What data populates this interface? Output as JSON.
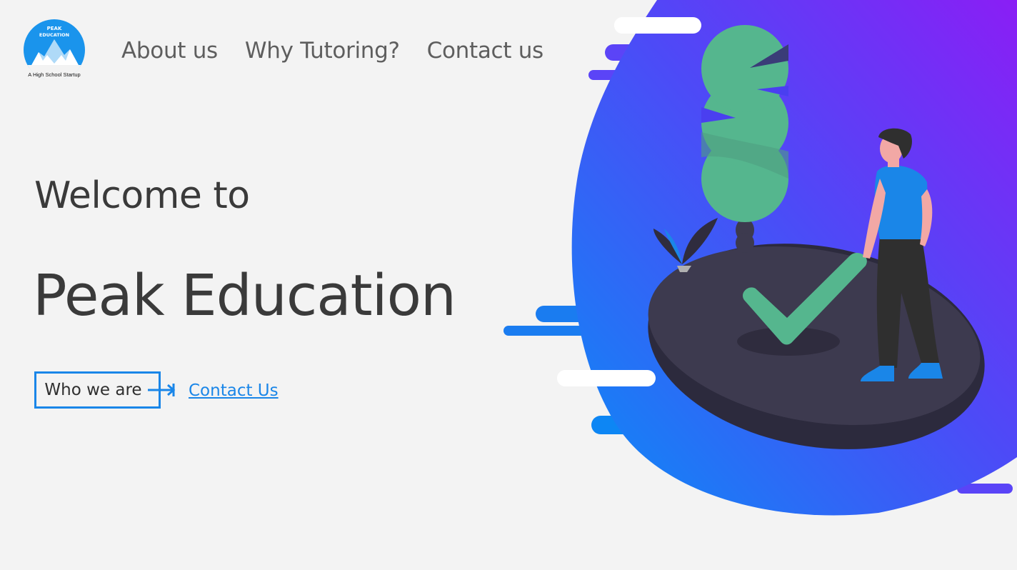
{
  "brand": {
    "logo_line1": "PEAK",
    "logo_line2": "EDUCATION",
    "tagline": "A High School Startup"
  },
  "nav": {
    "items": [
      {
        "label": "About us"
      },
      {
        "label": "Why Tutoring?"
      },
      {
        "label": "Contact us"
      }
    ]
  },
  "hero": {
    "subtitle": "Welcome to",
    "title": "Peak Education",
    "primary_button": "Who we are",
    "secondary_link": "Contact Us"
  },
  "colors": {
    "accent": "#1a86e8",
    "background": "#f3f3f3",
    "blob_start": "#0a8cf5",
    "blob_end": "#8a1ef5",
    "island": "#3d3a4f",
    "plant": "#55b68e"
  }
}
